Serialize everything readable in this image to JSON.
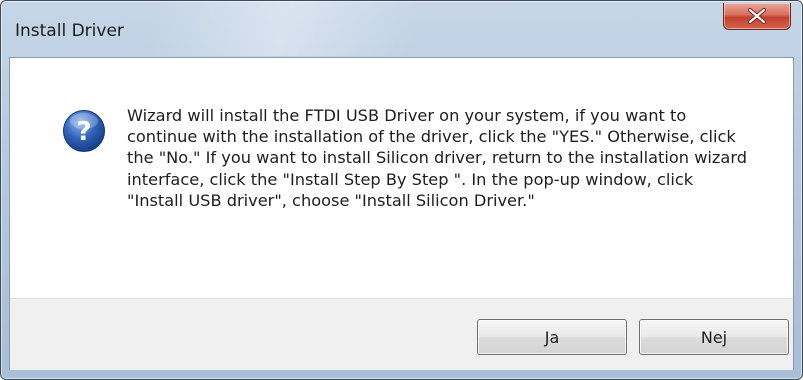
{
  "window": {
    "title": "Install Driver",
    "close_icon": "close-x-icon"
  },
  "dialog": {
    "icon": "question-icon",
    "message": "Wizard will install the FTDI USB Driver on your system, if you want to continue with the installation of the driver, click the \"YES.\" Otherwise, click the \"No.\" If you want to install Silicon driver, return to the installation wizard interface, click the \"Install Step By Step \". In the pop-up window, click \"Install USB driver\", choose \"Install Silicon Driver.\"",
    "buttons": {
      "yes_label": "Ja",
      "no_label": "Nej"
    }
  },
  "colors": {
    "close_button": "#c94a3a",
    "question_icon": "#2f62b8"
  }
}
